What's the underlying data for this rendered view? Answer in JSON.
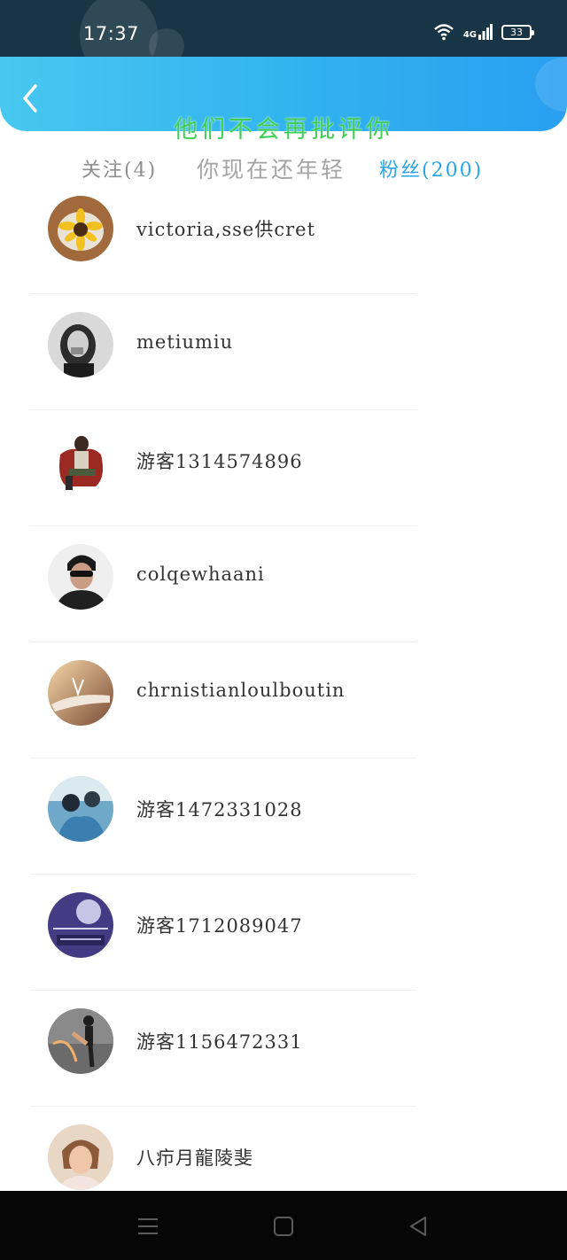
{
  "status_bar": {
    "time": "17:37",
    "network": "4G",
    "battery": "33"
  },
  "overlay": {
    "line1": "他们不会再批评你",
    "line2": "你现在还年轻"
  },
  "tabs": {
    "following": "关注(4)",
    "fans": "粉丝(200)"
  },
  "users": [
    {
      "name": "victoria,sse供cret",
      "avatar": "sunflower"
    },
    {
      "name": "metiumiu",
      "avatar": "portrait-gray"
    },
    {
      "name": "游客1314574896",
      "avatar": "chair-figure"
    },
    {
      "name": "colqewhaani",
      "avatar": "man-sunglasses"
    },
    {
      "name": "chrnistianloulboutin",
      "avatar": "hand-sunset"
    },
    {
      "name": "游客1472331028",
      "avatar": "couple-blue"
    },
    {
      "name": "游客1712089047",
      "avatar": "moon-purple"
    },
    {
      "name": "游客1156472331",
      "avatar": "kick-pose"
    },
    {
      "name": "八疖月龍陵斐",
      "avatar": "girl-portrait"
    }
  ],
  "colors": {
    "accent": "#27a6e6",
    "overlay_green": "#3ccf53",
    "header": "#30b2ef"
  }
}
